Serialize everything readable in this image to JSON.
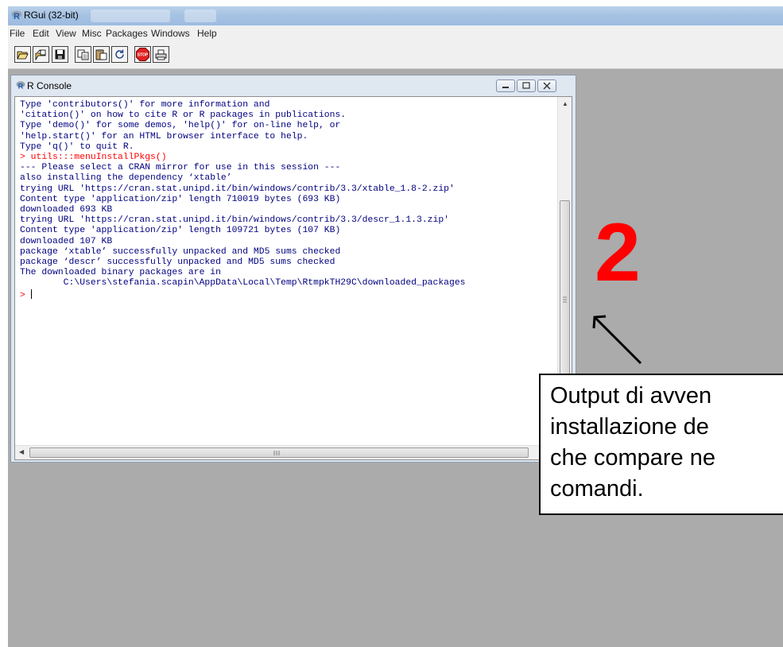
{
  "window": {
    "title": "RGui (32-bit)"
  },
  "menu": [
    "File",
    "Edit",
    "View",
    "Misc",
    "Packages",
    "Windows",
    "Help"
  ],
  "toolbar": {
    "buttons": [
      "open-script",
      "load-workspace",
      "save-workspace",
      "copy",
      "paste",
      "copy-paste",
      "stop",
      "print"
    ],
    "stop_label": "STOP"
  },
  "console": {
    "title": "R Console",
    "lines": [
      "Type 'contributors()' for more information and",
      "'citation()' on how to cite R or R packages in publications.",
      "",
      "Type 'demo()' for some demos, 'help()' for on-line help, or",
      "'help.start()' for an HTML browser interface to help.",
      "Type 'q()' to quit R.",
      "",
      "> utils:::menuInstallPkgs()",
      "--- Please select a CRAN mirror for use in this session ---",
      "also installing the dependency ‘xtable’",
      "",
      "trying URL 'https://cran.stat.unipd.it/bin/windows/contrib/3.3/xtable_1.8-2.zip'",
      "Content type 'application/zip' length 710019 bytes (693 KB)",
      "downloaded 693 KB",
      "",
      "trying URL 'https://cran.stat.unipd.it/bin/windows/contrib/3.3/descr_1.1.3.zip'",
      "Content type 'application/zip' length 109721 bytes (107 KB)",
      "downloaded 107 KB",
      "",
      "package ‘xtable’ successfully unpacked and MD5 sums checked",
      "package ‘descr’ successfully unpacked and MD5 sums checked",
      "",
      "The downloaded binary packages are in",
      "        C:\\Users\\stefania.scapin\\AppData\\Local\\Temp\\RtmpkTH29C\\downloaded_packages",
      "> "
    ],
    "text_color": "#000080",
    "command_color": "#ff0000"
  },
  "annotation": {
    "number": "2",
    "number_color": "#ff0000",
    "text_lines": [
      "Output di avven",
      "installazione de",
      "che compare ne",
      "comandi."
    ]
  }
}
